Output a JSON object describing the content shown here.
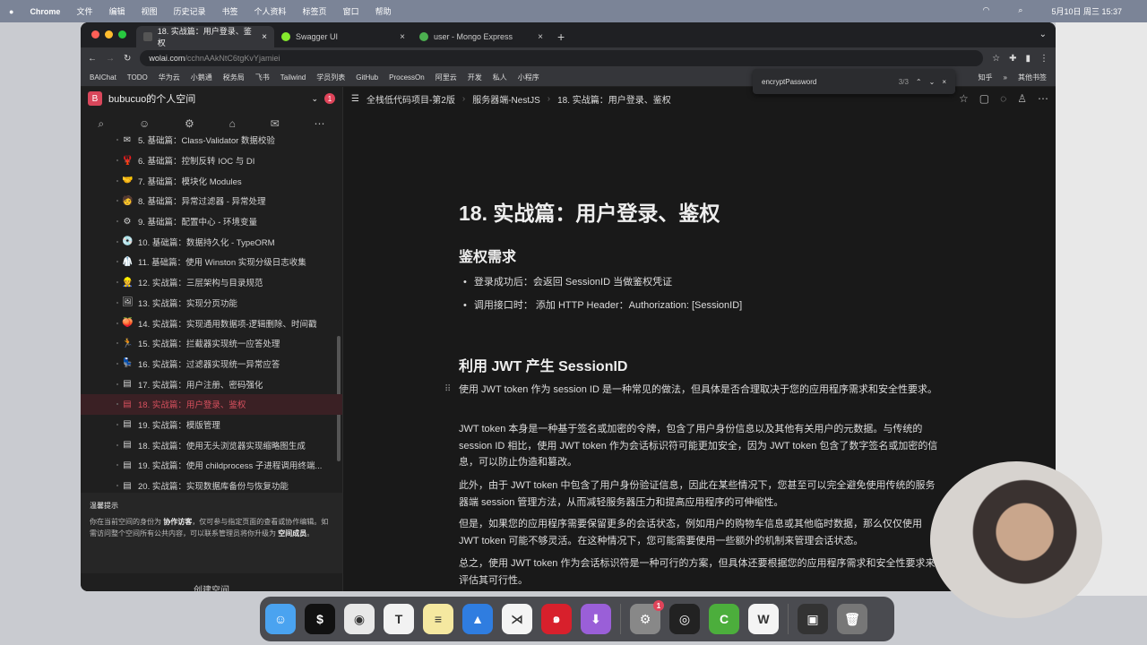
{
  "menubar": {
    "apple": "",
    "app": "Chrome",
    "items": [
      "文件",
      "编辑",
      "视图",
      "历史记录",
      "书签",
      "个人资料",
      "标签页",
      "窗口",
      "帮助"
    ],
    "clock": "5月10日 周三 15:37"
  },
  "tabs": [
    {
      "title": "18. 实战篇：用户登录、鉴权",
      "active": true
    },
    {
      "title": "Swagger UI"
    },
    {
      "title": "user - Mongo Express"
    }
  ],
  "new_tab": "+",
  "url": {
    "host": "wolai.com",
    "path": "/cchnAAkNtC6tgKvYjamiei"
  },
  "bookmarks": [
    "BAIChat",
    "TODO",
    "华为云",
    "小鹅通",
    "税务局",
    "飞书",
    "Tailwind",
    "学员列表",
    "GitHub",
    "ProcessOn",
    "阿里云",
    "开发",
    "私人",
    "小程序",
    "知乎",
    "»",
    "其他书签"
  ],
  "find": {
    "query": "encryptPassword",
    "count": "3/3"
  },
  "sidebar": {
    "logo": "B",
    "space": "bubucuo的个人空间",
    "badge": "1",
    "items": [
      {
        "icon": "✉",
        "label": "5. 基础篇：Class-Validator 数据校验"
      },
      {
        "icon": "🦞",
        "label": "6. 基础篇：控制反转 IOC 与 DI"
      },
      {
        "icon": "🤝",
        "label": "7. 基础篇：模块化 Modules"
      },
      {
        "icon": "🧑",
        "label": "8. 基础篇：异常过滤器 - 异常处理"
      },
      {
        "icon": "⚙",
        "label": "9. 基础篇：配置中心 - 环境变量"
      },
      {
        "icon": "💿",
        "label": "10. 基础篇：数据持久化 - TypeORM"
      },
      {
        "icon": "🥼",
        "label": "11. 基础篇：使用 Winston 实现分级日志收集"
      },
      {
        "icon": "👷",
        "label": "12. 实战篇：三层架构与目录规范"
      },
      {
        "icon": "🖼",
        "label": "13. 实战篇：实现分页功能"
      },
      {
        "icon": "🍑",
        "label": "14. 实战篇：实现通用数据项-逻辑删除、时间戳"
      },
      {
        "icon": "🏃",
        "label": "15. 实战篇：拦截器实现统一应答处理"
      },
      {
        "icon": "💺",
        "label": "16. 实战篇：过滤器实现统一异常应答"
      },
      {
        "icon": "▤",
        "label": "17. 实战篇：用户注册、密码强化"
      },
      {
        "icon": "▤",
        "label": "18. 实战篇：用户登录、鉴权",
        "active": true
      },
      {
        "icon": "▤",
        "label": "19. 实战篇：模版管理"
      },
      {
        "icon": "▤",
        "label": "18. 实战篇：使用无头浏览器实现缩略图生成"
      },
      {
        "icon": "▤",
        "label": "19. 实战篇：使用 childprocess 子进程调用终端..."
      },
      {
        "icon": "▤",
        "label": "20. 实战篇：实现数据库备份与恢复功能"
      }
    ],
    "tip_title": "温馨提示",
    "tip_a": "你在当前空间的身份为 ",
    "tip_b": "协作访客",
    "tip_c": "，仅可参与指定页面的查看或协作编辑。如需访问整个空间所有公共内容，可以联系管理员将你升级为 ",
    "tip_d": "空间成员",
    "tip_e": "。",
    "create": "创建空间"
  },
  "breadcrumb": [
    "全栈低代码项目-第2版",
    "服务器端-NestJS",
    "18. 实战篇：用户登录、鉴权"
  ],
  "doc": {
    "title": "18. 实战篇：用户登录、鉴权",
    "h_auth": "鉴权需求",
    "bullets": [
      "登录成功后：会返回 SessionID 当做鉴权凭证",
      "调用接口时： 添加 HTTP Header：Authorization: [SessionID]"
    ],
    "h_jwt": "利用 JWT 产生 SessionID",
    "paras": [
      "使用 JWT token 作为 session ID 是一种常见的做法，但具体是否合理取决于您的应用程序需求和安全性要求。",
      "JWT token 本身是一种基于签名或加密的令牌，包含了用户身份信息以及其他有关用户的元数据。与传统的 session ID 相比，使用 JWT token 作为会话标识符可能更加安全，因为 JWT token 包含了数字签名或加密的信息，可以防止伪造和篡改。",
      "此外，由于 JWT token 中包含了用户身份验证信息，因此在某些情况下，您甚至可以完全避免使用传统的服务器端 session 管理方法，从而减轻服务器压力和提高应用程序的可伸缩性。",
      "但是，如果您的应用程序需要保留更多的会话状态，例如用户的购物车信息或其他临时数据，那么仅仅使用 JWT token 可能不够灵活。在这种情况下，您可能需要使用一些额外的机制来管理会话状态。",
      "总之，使用 JWT token 作为会话标识符是一种可行的方案，但具体还要根据您的应用程序需求和安全性要求来评估其可行性。"
    ]
  },
  "dock": [
    {
      "name": "finder",
      "glyph": "☺",
      "color": "#4aa3f0"
    },
    {
      "name": "terminal",
      "glyph": "$",
      "color": "#111"
    },
    {
      "name": "chrome",
      "glyph": "◉",
      "color": "#e8e8e8"
    },
    {
      "name": "typora",
      "glyph": "T",
      "color": "#f2f2f2"
    },
    {
      "name": "notes",
      "glyph": "≡",
      "color": "#f5e8a0"
    },
    {
      "name": "keynote",
      "glyph": "▲",
      "color": "#2f7de0"
    },
    {
      "name": "vscode",
      "glyph": "⋊",
      "color": "#f4f4f4"
    },
    {
      "name": "netease-music",
      "glyph": "๑",
      "color": "#d8202c"
    },
    {
      "name": "downloader",
      "glyph": "⬇",
      "color": "#9a5fd8"
    },
    {
      "name": "system-settings",
      "glyph": "⚙",
      "color": "#888",
      "badge": "1"
    },
    {
      "name": "obs",
      "glyph": "◎",
      "color": "#222"
    },
    {
      "name": "camtasia",
      "glyph": "C",
      "color": "#4cae3c"
    },
    {
      "name": "wps",
      "glyph": "W",
      "color": "#f4f4f4"
    },
    {
      "name": "screen",
      "glyph": "▣",
      "color": "#333"
    },
    {
      "name": "trash",
      "glyph": "🗑",
      "color": "#777"
    }
  ]
}
